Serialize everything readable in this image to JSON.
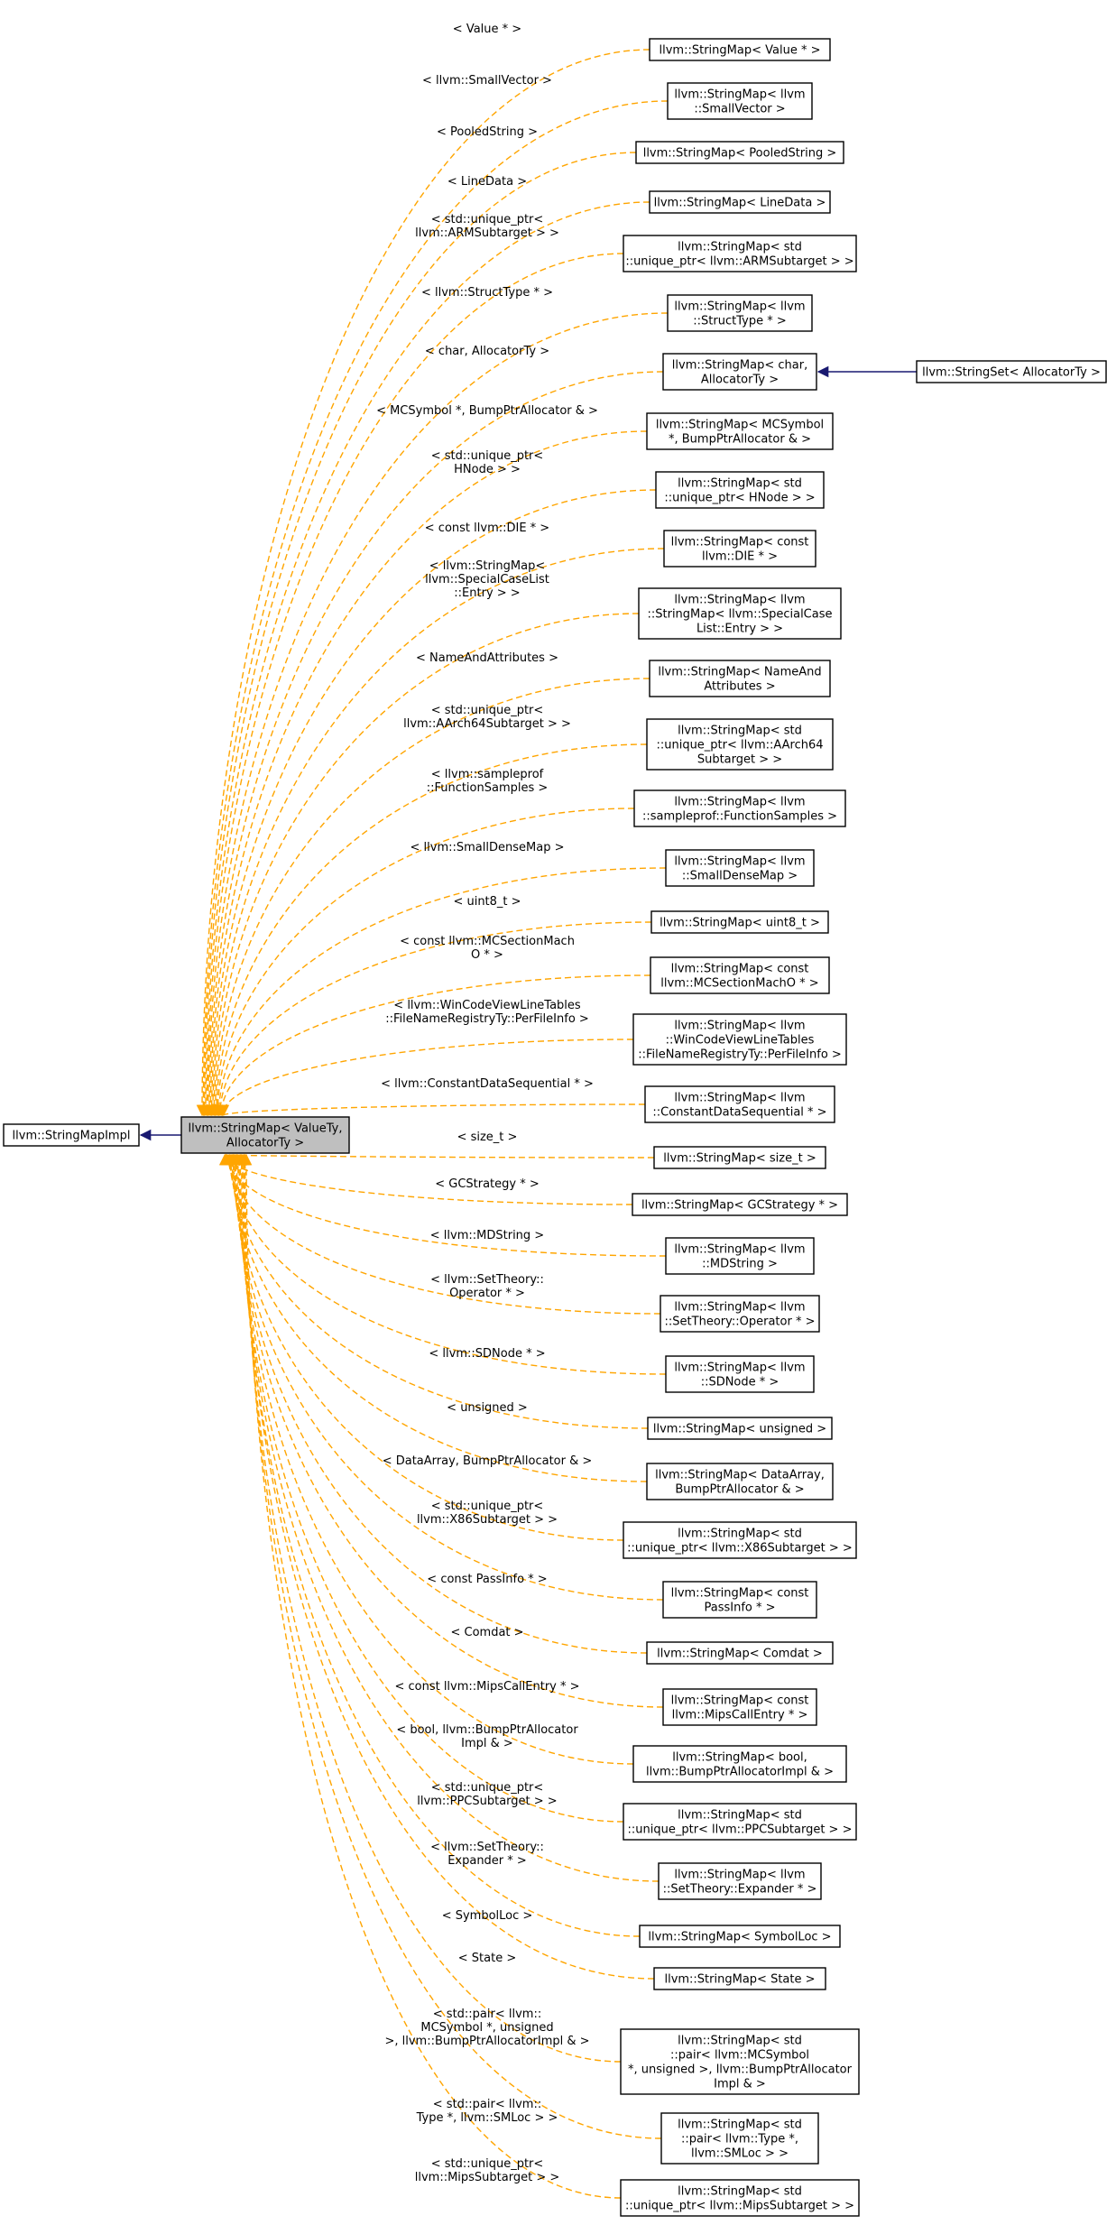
{
  "base": {
    "label": [
      "llvm::StringMapImpl"
    ]
  },
  "center": {
    "label": [
      "llvm::StringMap< ValueTy,",
      "AllocatorTy >"
    ]
  },
  "derived_from_char": {
    "label": [
      "llvm::StringSet< AllocatorTy >"
    ]
  },
  "colors": {
    "template_edge": "#ffa500",
    "inherit_edge": "#191970",
    "center_fill": "#bfbfbf"
  },
  "instantiations": [
    {
      "node": [
        "llvm::StringMap< Value * >"
      ],
      "edge": [
        "< Value * >"
      ]
    },
    {
      "node": [
        "llvm::StringMap< llvm",
        "::SmallVector >"
      ],
      "edge": [
        "< llvm::SmallVector >"
      ]
    },
    {
      "node": [
        "llvm::StringMap< PooledString >"
      ],
      "edge": [
        "< PooledString >"
      ]
    },
    {
      "node": [
        "llvm::StringMap< LineData >"
      ],
      "edge": [
        "< LineData >"
      ]
    },
    {
      "node": [
        "llvm::StringMap< std",
        "::unique_ptr< llvm::ARMSubtarget > >"
      ],
      "edge": [
        "< std::unique_ptr<",
        "llvm::ARMSubtarget > >"
      ]
    },
    {
      "node": [
        "llvm::StringMap< llvm",
        "::StructType * >"
      ],
      "edge": [
        "< llvm::StructType * >"
      ]
    },
    {
      "node": [
        "llvm::StringMap< char,",
        "AllocatorTy >"
      ],
      "edge": [
        "< char, AllocatorTy >"
      ]
    },
    {
      "node": [
        "llvm::StringMap< MCSymbol",
        "*, BumpPtrAllocator & >"
      ],
      "edge": [
        "< MCSymbol *, BumpPtrAllocator & >"
      ]
    },
    {
      "node": [
        "llvm::StringMap< std",
        "::unique_ptr< HNode > >"
      ],
      "edge": [
        "< std::unique_ptr<",
        "HNode > >"
      ]
    },
    {
      "node": [
        "llvm::StringMap< const",
        "llvm::DIE * >"
      ],
      "edge": [
        "< const llvm::DIE * >"
      ]
    },
    {
      "node": [
        "llvm::StringMap< llvm",
        "::StringMap< llvm::SpecialCase",
        "List::Entry > >"
      ],
      "edge": [
        "< llvm::StringMap<",
        "llvm::SpecialCaseList",
        "::Entry > >"
      ]
    },
    {
      "node": [
        "llvm::StringMap< NameAnd",
        "Attributes >"
      ],
      "edge": [
        "< NameAndAttributes >"
      ]
    },
    {
      "node": [
        "llvm::StringMap< std",
        "::unique_ptr< llvm::AArch64",
        "Subtarget > >"
      ],
      "edge": [
        "< std::unique_ptr<",
        "llvm::AArch64Subtarget > >"
      ]
    },
    {
      "node": [
        "llvm::StringMap< llvm",
        "::sampleprof::FunctionSamples >"
      ],
      "edge": [
        "< llvm::sampleprof",
        "::FunctionSamples >"
      ]
    },
    {
      "node": [
        "llvm::StringMap< llvm",
        "::SmallDenseMap >"
      ],
      "edge": [
        "< llvm::SmallDenseMap >"
      ]
    },
    {
      "node": [
        "llvm::StringMap< uint8_t >"
      ],
      "edge": [
        "< uint8_t >"
      ]
    },
    {
      "node": [
        "llvm::StringMap< const",
        "llvm::MCSectionMachO * >"
      ],
      "edge": [
        "< const llvm::MCSectionMach",
        "O * >"
      ]
    },
    {
      "node": [
        "llvm::StringMap< llvm",
        "::WinCodeViewLineTables",
        "::FileNameRegistryTy::PerFileInfo >"
      ],
      "edge": [
        "< llvm::WinCodeViewLineTables",
        "::FileNameRegistryTy::PerFileInfo >"
      ]
    },
    {
      "node": [
        "llvm::StringMap< llvm",
        "::ConstantDataSequential * >"
      ],
      "edge": [
        "< llvm::ConstantDataSequential * >"
      ]
    },
    {
      "node": [
        "llvm::StringMap< size_t >"
      ],
      "edge": [
        "< size_t >"
      ]
    },
    {
      "node": [
        "llvm::StringMap< GCStrategy * >"
      ],
      "edge": [
        "< GCStrategy * >"
      ]
    },
    {
      "node": [
        "llvm::StringMap< llvm",
        "::MDString >"
      ],
      "edge": [
        "< llvm::MDString >"
      ]
    },
    {
      "node": [
        "llvm::StringMap< llvm",
        "::SetTheory::Operator * >"
      ],
      "edge": [
        "< llvm::SetTheory::",
        "Operator * >"
      ]
    },
    {
      "node": [
        "llvm::StringMap< llvm",
        "::SDNode * >"
      ],
      "edge": [
        "< llvm::SDNode * >"
      ]
    },
    {
      "node": [
        "llvm::StringMap< unsigned >"
      ],
      "edge": [
        "< unsigned >"
      ]
    },
    {
      "node": [
        "llvm::StringMap< DataArray,",
        "BumpPtrAllocator & >"
      ],
      "edge": [
        "< DataArray, BumpPtrAllocator & >"
      ]
    },
    {
      "node": [
        "llvm::StringMap< std",
        "::unique_ptr< llvm::X86Subtarget > >"
      ],
      "edge": [
        "< std::unique_ptr<",
        "llvm::X86Subtarget > >"
      ]
    },
    {
      "node": [
        "llvm::StringMap< const",
        "PassInfo * >"
      ],
      "edge": [
        "< const PassInfo * >"
      ]
    },
    {
      "node": [
        "llvm::StringMap< Comdat >"
      ],
      "edge": [
        "< Comdat >"
      ]
    },
    {
      "node": [
        "llvm::StringMap< const",
        "llvm::MipsCallEntry * >"
      ],
      "edge": [
        "< const llvm::MipsCallEntry * >"
      ]
    },
    {
      "node": [
        "llvm::StringMap< bool,",
        "llvm::BumpPtrAllocatorImpl & >"
      ],
      "edge": [
        "< bool, llvm::BumpPtrAllocator",
        "Impl & >"
      ]
    },
    {
      "node": [
        "llvm::StringMap< std",
        "::unique_ptr< llvm::PPCSubtarget > >"
      ],
      "edge": [
        "< std::unique_ptr<",
        "llvm::PPCSubtarget > >"
      ]
    },
    {
      "node": [
        "llvm::StringMap< llvm",
        "::SetTheory::Expander * >"
      ],
      "edge": [
        "< llvm::SetTheory::",
        "Expander * >"
      ]
    },
    {
      "node": [
        "llvm::StringMap< SymbolLoc >"
      ],
      "edge": [
        "< SymbolLoc >"
      ]
    },
    {
      "node": [
        "llvm::StringMap< State >"
      ],
      "edge": [
        "< State >"
      ]
    },
    {
      "node": [
        "llvm::StringMap< std",
        "::pair< llvm::MCSymbol",
        " *, unsigned >, llvm::BumpPtrAllocator",
        "Impl & >"
      ],
      "edge": [
        "< std::pair< llvm::",
        "MCSymbol *, unsigned",
        ">, llvm::BumpPtrAllocatorImpl & >"
      ]
    },
    {
      "node": [
        "llvm::StringMap< std",
        "::pair< llvm::Type *,",
        "llvm::SMLoc > >"
      ],
      "edge": [
        "< std::pair< llvm::",
        "Type *, llvm::SMLoc > >"
      ]
    },
    {
      "node": [
        "llvm::StringMap< std",
        "::unique_ptr< llvm::MipsSubtarget > >"
      ],
      "edge": [
        "< std::unique_ptr<",
        "llvm::MipsSubtarget > >"
      ]
    }
  ]
}
